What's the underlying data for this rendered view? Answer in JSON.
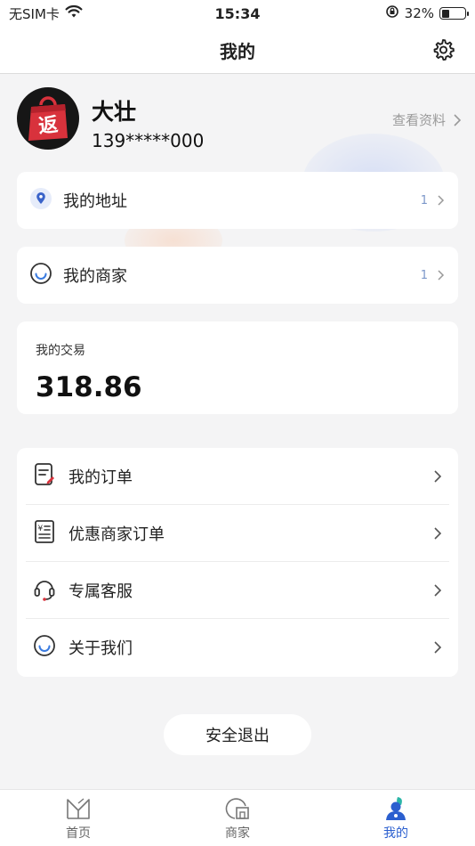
{
  "status_bar": {
    "carrier": "无SIM卡",
    "time": "15:34",
    "battery": "32%",
    "battery_level": 0.32
  },
  "nav": {
    "title": "我的"
  },
  "profile": {
    "name": "大壮",
    "phone": "139*****000",
    "view_profile": "查看资料",
    "avatar_glyph": "返"
  },
  "address": {
    "label": "我的地址",
    "count": "1"
  },
  "merchant": {
    "label": "我的商家",
    "count": "1"
  },
  "trade": {
    "label": "我的交易",
    "value": "318.86"
  },
  "menu": [
    {
      "label": "我的订单",
      "icon": "order-icon"
    },
    {
      "label": "优惠商家订单",
      "icon": "receipt-icon"
    },
    {
      "label": "专属客服",
      "icon": "headset-icon"
    },
    {
      "label": "关于我们",
      "icon": "smile-icon"
    }
  ],
  "logout": {
    "label": "安全退出"
  },
  "tabs": [
    {
      "label": "首页",
      "icon": "home-icon",
      "active": false
    },
    {
      "label": "商家",
      "icon": "store-icon",
      "active": false
    },
    {
      "label": "我的",
      "icon": "profile-icon",
      "active": true
    }
  ],
  "colors": {
    "accent": "#2b5fcf",
    "count": "#7b97c9",
    "background": "#f4f4f5",
    "avatar_bag": "#d8323c"
  }
}
